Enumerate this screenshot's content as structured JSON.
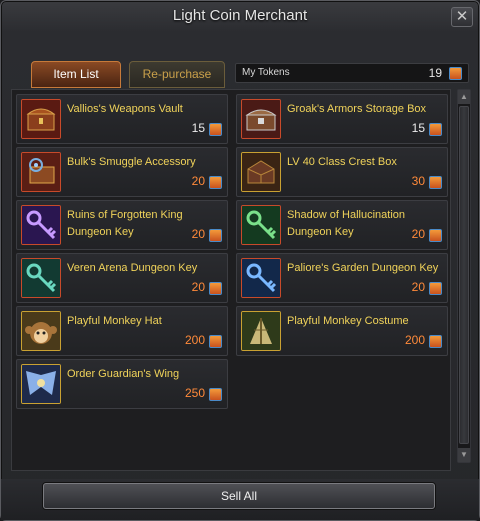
{
  "window": {
    "title": "Light Coin Merchant",
    "close_glyph": "✕"
  },
  "tabs": [
    {
      "label": "Item List",
      "active": true
    },
    {
      "label": "Re-purchase",
      "active": false
    }
  ],
  "tokens": {
    "label": "My Tokens",
    "value": "19",
    "icon": "token-coin-icon"
  },
  "items": [
    {
      "name": "Vallios's Weapons Vault",
      "price": "15",
      "icon": "weapons-vault-chest-icon"
    },
    {
      "name": "Groak's Armors Storage Box",
      "price": "15",
      "icon": "armors-storage-chest-icon"
    },
    {
      "name": "Bulk's Smuggle Accessory",
      "price": "20",
      "icon": "accessory-chest-icon"
    },
    {
      "name": "LV 40 Class Crest Box",
      "price": "30",
      "icon": "crest-box-icon"
    },
    {
      "name": "Ruins of Forgotten King Dungeon Key",
      "price": "20",
      "icon": "purple-key-icon"
    },
    {
      "name": "Shadow of Hallucination Dungeon Key",
      "price": "20",
      "icon": "green-key-icon"
    },
    {
      "name": "Veren Arena Dungeon Key",
      "price": "20",
      "icon": "teal-key-icon"
    },
    {
      "name": "Paliore's Garden Dungeon Key",
      "price": "20",
      "icon": "blue-key-icon"
    },
    {
      "name": "Playful Monkey Hat",
      "price": "200",
      "icon": "monkey-hat-icon"
    },
    {
      "name": "Playful Monkey Costume",
      "price": "200",
      "icon": "monkey-costume-icon"
    },
    {
      "name": "Order Guardian's Wing",
      "price": "250",
      "icon": "guardian-wing-icon"
    }
  ],
  "footer": {
    "sell_all_label": "Sell All"
  },
  "colors": {
    "item_name": "#f0d35a",
    "price": "#ff8a3a",
    "tab_active": "#8a4a24",
    "tab_inactive_text": "#c9a04a"
  }
}
